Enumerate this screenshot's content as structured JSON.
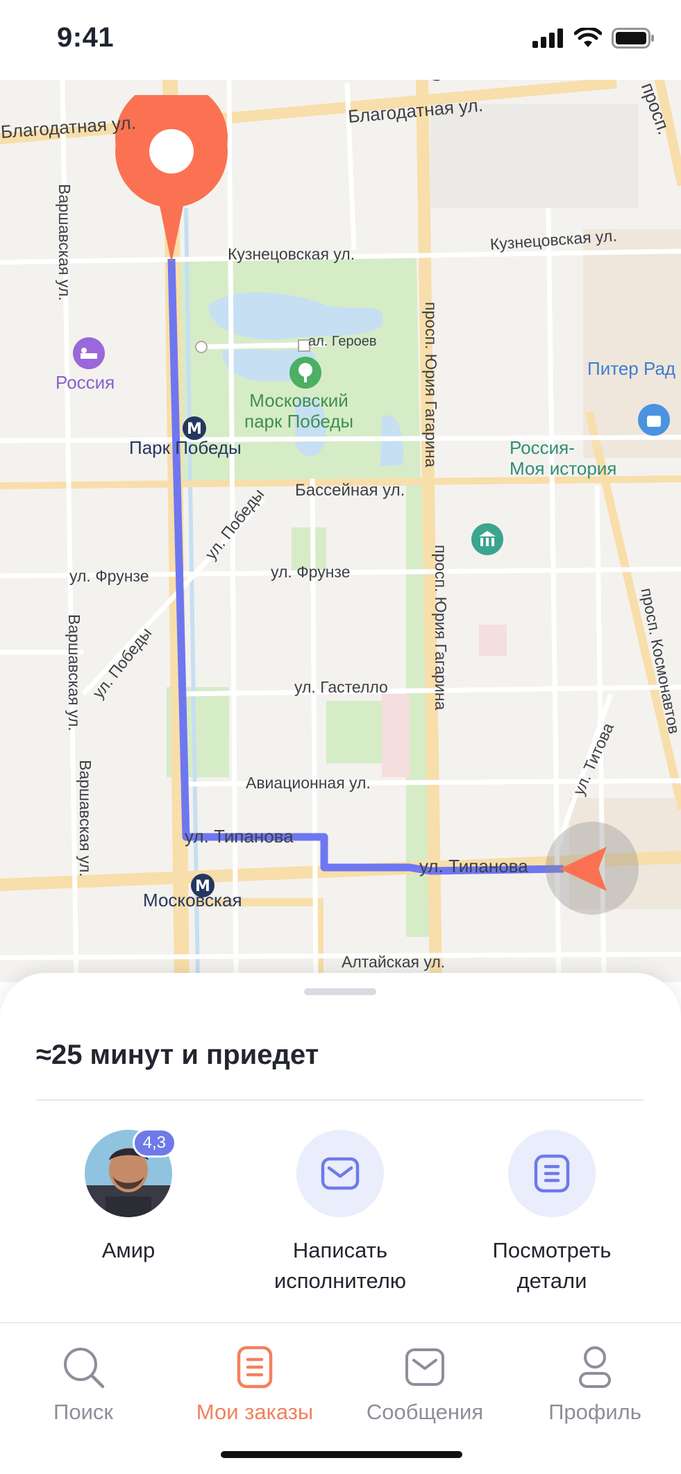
{
  "status_bar": {
    "time": "9:41"
  },
  "map": {
    "streets": [
      "Благодатная ул.",
      "Благодатная ул.",
      "Кузнецовская ул.",
      "Кузнецовская ул.",
      "ал. Героев",
      "Бассейная ул.",
      "ул. Фрунзе",
      "ул. Фрунзе",
      "ул. Гастелло",
      "Авиационная ул.",
      "ул. Типанова",
      "ул. Типанова",
      "Алтайская ул.",
      "Варшавская ул.",
      "Варшавская ул.",
      "Варшавская ул.",
      "просп. Юрия Гагарина",
      "просп. Юрия Гагарина",
      "просп. Космонавтов",
      "ул. Победы",
      "ул. Победы",
      "ул. Титова",
      "просп.",
      "Сы"
    ],
    "pois": {
      "hotel": "Россия",
      "metro_park": "Парк Победы",
      "park": "Московский\nпарк Победы",
      "museum": "Россия-\nМоя история",
      "shop": "Питер Рад",
      "metro_moskovskaya": "Московская"
    },
    "route_color": "#6e77f0",
    "pin_color": "#fa7252"
  },
  "sheet": {
    "eta": "≈25 минут и приедет",
    "courier": {
      "name": "Амир",
      "rating": "4,3"
    },
    "message_action": "Написать\nисполнителю",
    "details_action": "Посмотреть\nдетали"
  },
  "tabs": [
    {
      "label": "Поиск",
      "icon": "search-icon"
    },
    {
      "label": "Мои заказы",
      "icon": "orders-icon",
      "active": true
    },
    {
      "label": "Сообщения",
      "icon": "messages-icon"
    },
    {
      "label": "Профиль",
      "icon": "profile-icon"
    }
  ],
  "colors": {
    "accent": "#f3805e",
    "primary": "#6e7ae7",
    "inactive": "#8c8f99"
  }
}
